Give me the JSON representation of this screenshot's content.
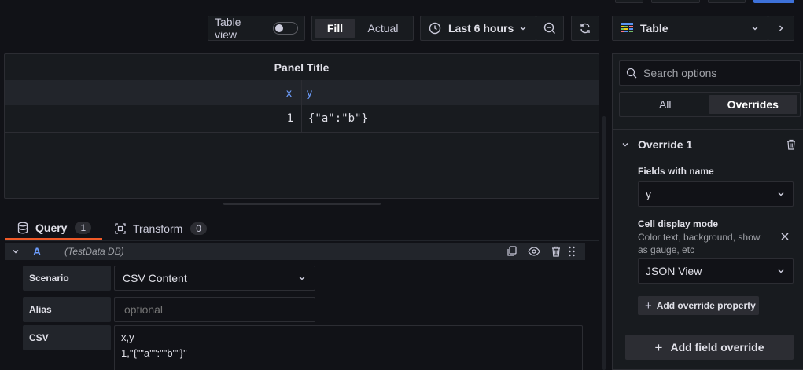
{
  "toolbar": {
    "table_view_label": "Table view",
    "fill_label": "Fill",
    "actual_label": "Actual",
    "time_range_label": "Last 6 hours",
    "viz_label": "Table"
  },
  "panel": {
    "title": "Panel Title",
    "columns": [
      "x",
      "y"
    ],
    "rows": [
      [
        "1",
        "{\"a\":\"b\"}"
      ]
    ]
  },
  "tabs": {
    "query_label": "Query",
    "query_count": "1",
    "transform_label": "Transform",
    "transform_count": "0"
  },
  "query_row": {
    "ref_id": "A",
    "datasource": "(TestData DB)",
    "scenario_label": "Scenario",
    "scenario_value": "CSV Content",
    "alias_label": "Alias",
    "alias_placeholder": "optional",
    "csv_label": "CSV",
    "csv_line1": "x,y",
    "csv_line2": "1,\"{\"\"a\"\":\"\"b\"\"}\""
  },
  "options": {
    "search_placeholder": "Search options",
    "tab_all": "All",
    "tab_overrides": "Overrides",
    "override_title": "Override 1",
    "fields_with_name_label": "Fields with name",
    "fields_with_name_value": "y",
    "cell_display_label": "Cell display mode",
    "cell_display_desc": "Color text, background, show as gauge, etc",
    "cell_display_value": "JSON View",
    "add_override_property": "Add override property",
    "add_field_override": "Add field override"
  },
  "colors": {
    "background": "#111217",
    "panel": "#181b1f",
    "accent_blue": "#6e9fff",
    "primary": "#3d71d9",
    "tab_underline": "#f05a28"
  }
}
